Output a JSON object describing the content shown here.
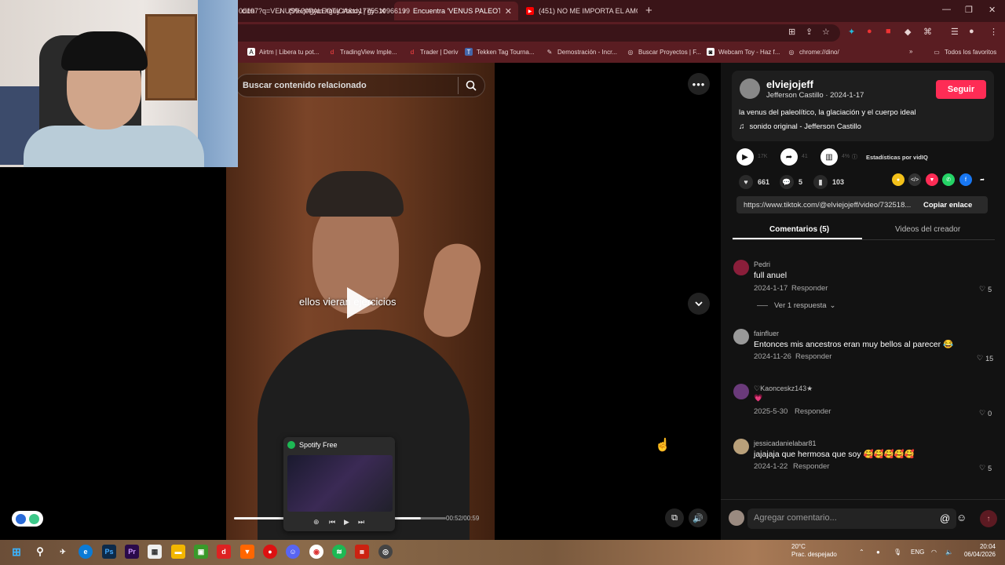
{
  "browser": {
    "tabs": [
      {
        "label": "ción",
        "active": false,
        "icon": "generic-icon"
      },
      {
        "label": "(99+)#gym #guy #body | gym",
        "active": false,
        "icon": "tiktok-icon"
      },
      {
        "label": "Encuentra 'VENUS PALEOTICA'",
        "active": true,
        "icon": "tiktok-icon"
      },
      {
        "label": "(451) NO ME IMPORTA EL AMO",
        "active": false,
        "icon": "youtube-icon"
      }
    ],
    "url": "00197?q=VENUS%20PALEOTICA&t=1775519966199",
    "bookmarks": [
      {
        "label": "Airtm | Libera tu pot...",
        "icon": "airtm-icon"
      },
      {
        "label": "TradingView Imple...",
        "icon": "deriv-icon"
      },
      {
        "label": "Trader | Deriv",
        "icon": "deriv-icon"
      },
      {
        "label": "Tekken Tag Tourna...",
        "icon": "tekken-icon"
      },
      {
        "label": "Demostración - Incr...",
        "icon": "demo-icon"
      },
      {
        "label": "Buscar Proyectos | F...",
        "icon": "globe-icon"
      },
      {
        "label": "Webcam Toy - Haz f...",
        "icon": "webcam-icon"
      },
      {
        "label": "chrome://dino/",
        "icon": "globe-icon"
      }
    ],
    "all_bookmarks": "Todos los favoritos"
  },
  "video": {
    "search_placeholder": "Buscar contenido relacionado",
    "caption": "ellos vieran ejercicios",
    "time": "00:52/00:59",
    "progress": 0.88
  },
  "spotify": {
    "title": "Spotify Free"
  },
  "post": {
    "username": "elviejojeff",
    "meta": "Jefferson Castillo · 2024-1-17",
    "follow_label": "Seguir",
    "description": "la venus del paleolítico, la glaciación y el cuerpo ideal",
    "sound": "sonido original - Jefferson Castillo",
    "plays": "17K",
    "shares": "41",
    "engagement": "4%",
    "stats_label": "Estadísticas por vidIQ",
    "likes": "661",
    "comments": "5",
    "saves": "103",
    "link": "https://www.tiktok.com/@elviejojeff/video/732518...",
    "copy_label": "Copiar enlace",
    "tab_comments": "Comentarios (5)",
    "tab_creator": "Videos del creador"
  },
  "comments": [
    {
      "user": "Pedri",
      "text": "full anuel",
      "date": "2024-1-17",
      "reply": "Responder",
      "likes": "5",
      "view_replies": "Ver 1 respuesta"
    },
    {
      "user": "fainfluer",
      "text": "Entonces mis ancestros eran muy bellos al parecer 😂",
      "date": "2024-11-26",
      "reply": "Responder",
      "likes": "15"
    },
    {
      "user": "♡Kaonceskz143★",
      "text": "💗",
      "date": "2025-5-30",
      "reply": "Responder",
      "likes": "0"
    },
    {
      "user": "jessicadanielabar81",
      "text": "jajajaja que hermosa que soy 🥰🥰🥰🥰🥰",
      "date": "2024-1-22",
      "reply": "Responder",
      "likes": "5"
    }
  ],
  "comment_placeholder": "Agregar comentario...",
  "taskbar": {
    "weather_temp": "20°C",
    "weather_desc": "Prac. despejado",
    "lang": "ENG",
    "time": "20:04",
    "date": "06/04/2026"
  },
  "colors": {
    "tiktok_red": "#fe2c55",
    "chrome_frame": "#5a1d22",
    "spotify_green": "#1db954"
  }
}
